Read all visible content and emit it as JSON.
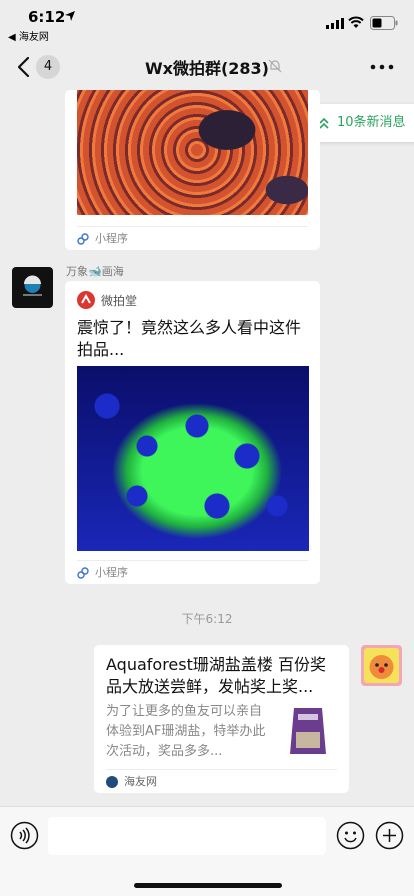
{
  "status_bar": {
    "time": "6:12",
    "back_app": "◀ 海友网"
  },
  "nav": {
    "unread_count": "4",
    "title": "Wx微拍群(283)"
  },
  "new_messages": {
    "label": "10条新消息"
  },
  "messages": [
    {
      "type": "mini_program",
      "footer_label": "小程序"
    },
    {
      "type": "mini_program",
      "sender": "万象🐋画海",
      "source_name": "微拍堂",
      "title": "震惊了！竟然这么多人看中这件拍品...",
      "footer_label": "小程序"
    },
    {
      "type": "timestamp",
      "text": "下午6:12"
    },
    {
      "type": "article",
      "title": "Aquaforest珊湖盐盖楼 百份奖品大放送尝鲜，发帖奖上奖...",
      "description": "为了让更多的鱼友可以亲自体验到AF珊湖盐，特举办此次活动，奖品多多...",
      "site_name": "海友网"
    }
  ],
  "colors": {
    "accent_green": "#2aa35f",
    "background": "#ededed"
  },
  "icons": {
    "back": "chevron-left",
    "mute": "bell-slash",
    "more": "ellipsis",
    "voice": "voice-wave",
    "emoji": "smiley",
    "plus": "plus-circle"
  }
}
